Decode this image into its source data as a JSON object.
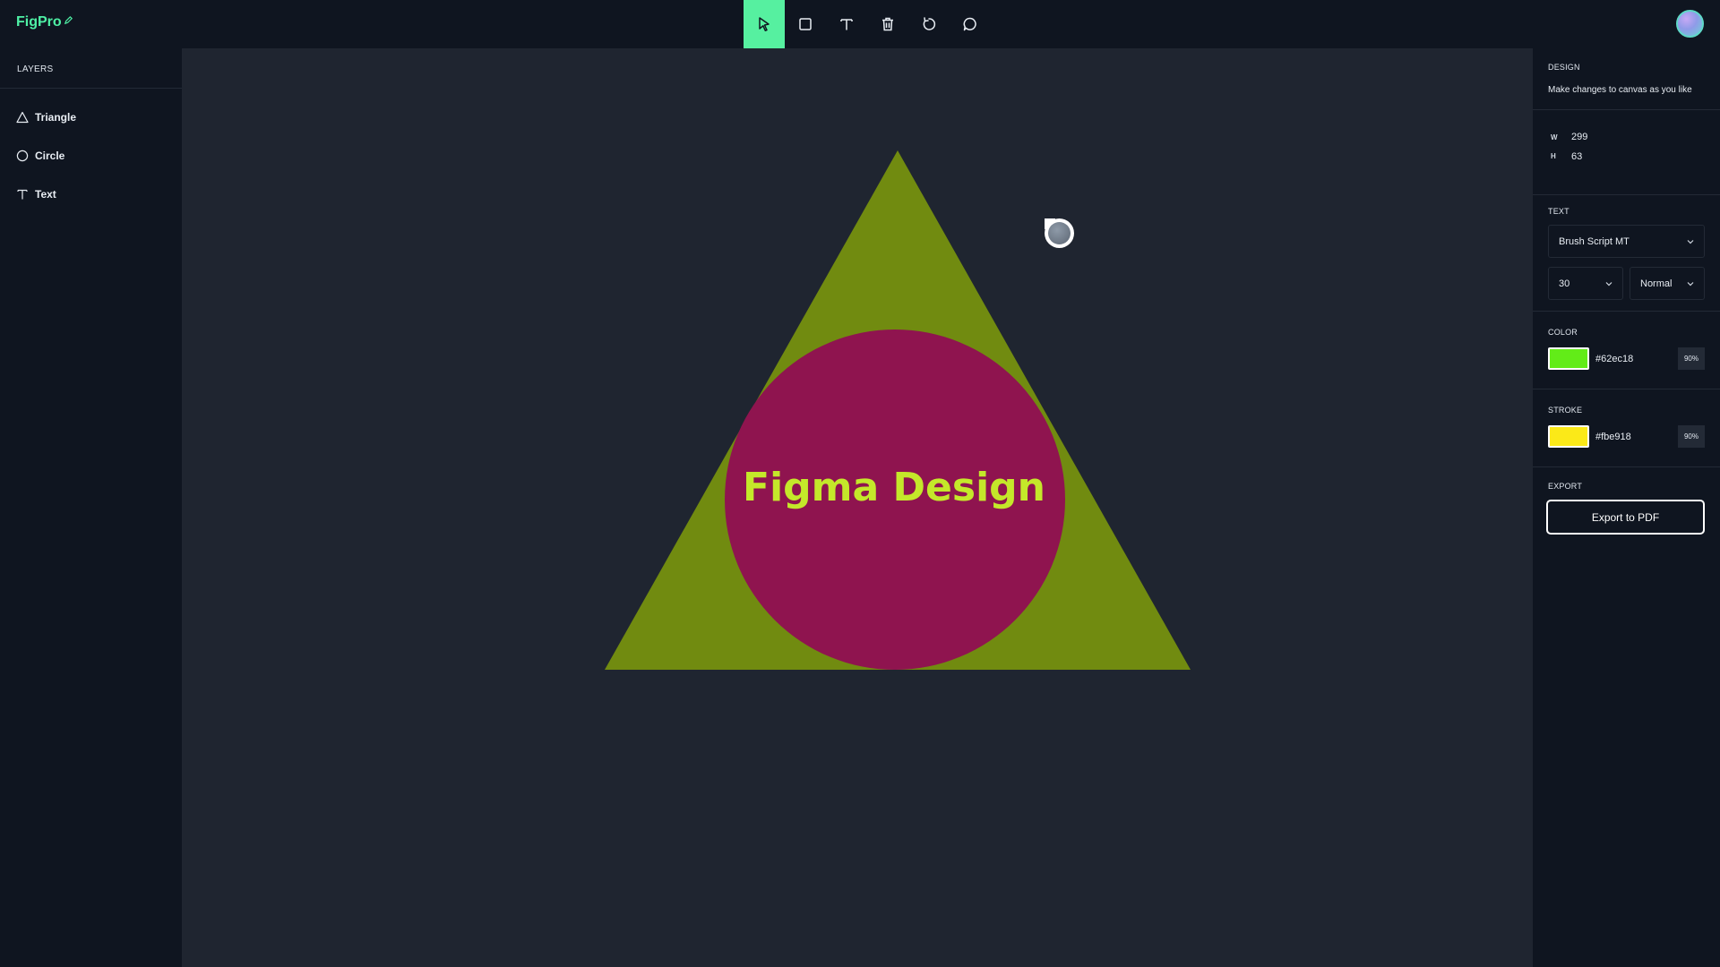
{
  "app": {
    "name": "FigPro"
  },
  "toolbar": {
    "tools": [
      {
        "name": "select",
        "icon": "cursor-arrow-icon",
        "active": true
      },
      {
        "name": "rectangle",
        "icon": "square-icon"
      },
      {
        "name": "text",
        "icon": "text-icon"
      },
      {
        "name": "delete",
        "icon": "trash-icon"
      },
      {
        "name": "reset",
        "icon": "reset-icon"
      },
      {
        "name": "comment",
        "icon": "comment-icon"
      }
    ]
  },
  "layers": {
    "title": "LAYERS",
    "items": [
      {
        "label": "Triangle",
        "icon": "triangle-icon"
      },
      {
        "label": "Circle",
        "icon": "circle-icon"
      },
      {
        "label": "Text",
        "icon": "text-icon"
      }
    ]
  },
  "canvas": {
    "text": "Figma Design",
    "triangle_color": "#718b10",
    "circle_color": "#8f144f",
    "text_color": "#c4e82a"
  },
  "design": {
    "title": "DESIGN",
    "subtitle": "Make changes to canvas as you like",
    "width_label": "W",
    "width": "299",
    "height_label": "H",
    "height": "63"
  },
  "text_settings": {
    "title": "TEXT",
    "font_family": "Brush Script MT",
    "font_size": "30",
    "font_weight": "Normal"
  },
  "color": {
    "title": "COLOR",
    "swatch": "#62ec18",
    "hex": "#62ec18",
    "opacity": "90%"
  },
  "stroke": {
    "title": "STROKE",
    "swatch": "#fbe918",
    "hex": "#fbe918",
    "opacity": "90%"
  },
  "export": {
    "title": "EXPORT",
    "button_label": "Export to PDF"
  }
}
